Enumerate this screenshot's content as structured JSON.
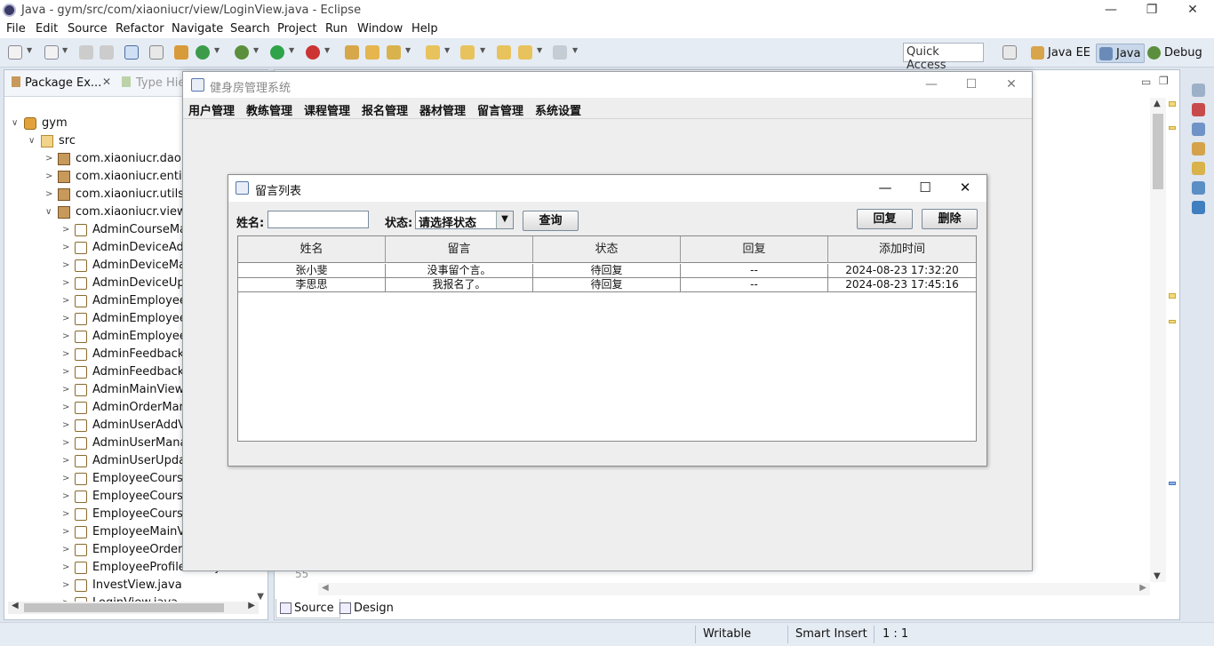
{
  "eclipse": {
    "title": "Java - gym/src/com/xiaoniucr/view/LoginView.java - Eclipse",
    "window_controls": {
      "minimize": "—",
      "maximize": "❐",
      "close": "✕"
    },
    "menu": [
      "File",
      "Edit",
      "Source",
      "Refactor",
      "Navigate",
      "Search",
      "Project",
      "Run",
      "Window",
      "Help"
    ],
    "quick_access": "Quick Access",
    "perspectives": [
      "Java EE",
      "Java",
      "Debug"
    ],
    "active_perspective": "Java"
  },
  "package_explorer": {
    "tabs": [
      "Package Ex...",
      "Type Hie"
    ],
    "project": "gym",
    "src": "src",
    "packages": [
      "com.xiaoniucr.dao",
      "com.xiaoniucr.entity",
      "com.xiaoniucr.utils",
      "com.xiaoniucr.view"
    ],
    "files": [
      "AdminCourseMan",
      "AdminDeviceAdd",
      "AdminDeviceMan",
      "AdminDeviceUpd",
      "AdminEmployeeA",
      "AdminEmployeeM",
      "AdminEmployeeU",
      "AdminFeedbackM",
      "AdminFeedbackR",
      "AdminMainView.j",
      "AdminOrderMan",
      "AdminUserAddVi",
      "AdminUserManag",
      "AdminUserUpdat",
      "EmployeeCourse",
      "EmployeeCourse",
      "EmployeeCourse",
      "EmployeeMainVie",
      "EmployeeOrderM",
      "EmployeeProfileView.java",
      "InvestView.java",
      "LoginView.java"
    ]
  },
  "editor": {
    "line_number": "55",
    "tabs": [
      "Source",
      "Design"
    ]
  },
  "statusbar": {
    "writable": "Writable",
    "insert_mode": "Smart Insert",
    "position": "1 : 1"
  },
  "swing_app": {
    "title": "健身房管理系统",
    "menu": [
      "用户管理",
      "教练管理",
      "课程管理",
      "报名管理",
      "器材管理",
      "留言管理",
      "系统设置"
    ]
  },
  "message_frame": {
    "title": "留言列表",
    "name_label": "姓名:",
    "name_value": "",
    "status_label": "状态:",
    "status_selected": "请选择状态",
    "query_button": "查询",
    "reply_button": "回复",
    "delete_button": "删除",
    "table": {
      "columns": [
        "姓名",
        "留言",
        "状态",
        "回复",
        "添加时间"
      ],
      "rows": [
        [
          "张小斐",
          "没事留个言。",
          "待回复",
          "--",
          "2024-08-23 17:32:20"
        ],
        [
          "李思思",
          "我报名了。",
          "待回复",
          "--",
          "2024-08-23 17:45:16"
        ]
      ]
    }
  },
  "colors": {
    "eclipse_chrome": "#e6ecf4",
    "swing_background": "#eeeeee",
    "active_perspective": "#c8d8ea"
  }
}
